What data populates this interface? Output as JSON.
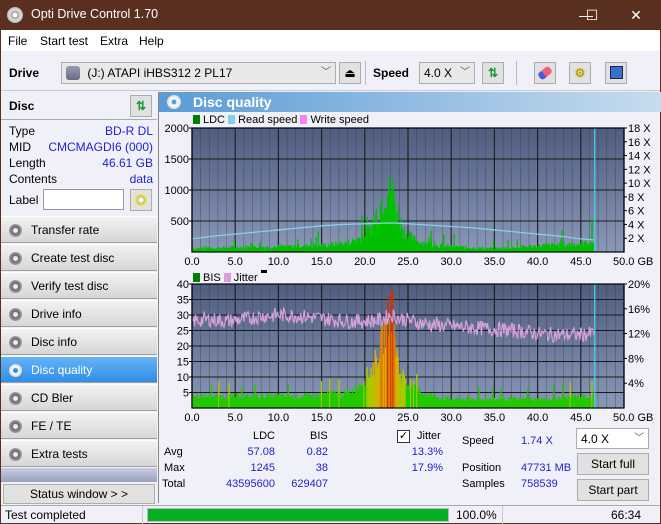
{
  "window": {
    "title": "Opti Drive Control 1.70",
    "minimize": "—",
    "maximize": "☐",
    "close": "✕"
  },
  "menu": [
    "File",
    "Start test",
    "Extra",
    "Help"
  ],
  "toolbar": {
    "drive_label": "Drive",
    "drive_value": "(J:)  ATAPI iHBS312  2 PL17",
    "speed_label": "Speed",
    "speed_value": "4.0 X",
    "icons": [
      "eject-icon",
      "refresh-icon",
      "erase-icon",
      "settings-icon",
      "save-icon"
    ]
  },
  "disc": {
    "title": "Disc",
    "fields": [
      {
        "key": "Type",
        "value": "BD-R DL"
      },
      {
        "key": "MID",
        "value": "CMCMAGDI6 (000)"
      },
      {
        "key": "Length",
        "value": "46.61 GB"
      },
      {
        "key": "Contents",
        "value": "data"
      }
    ],
    "label_key": "Label",
    "label_value": ""
  },
  "nav": [
    {
      "label": "Transfer rate",
      "active": false
    },
    {
      "label": "Create test disc",
      "active": false
    },
    {
      "label": "Verify test disc",
      "active": false
    },
    {
      "label": "Drive info",
      "active": false
    },
    {
      "label": "Disc info",
      "active": false
    },
    {
      "label": "Disc quality",
      "active": true
    },
    {
      "label": "CD Bler",
      "active": false
    },
    {
      "label": "FE / TE",
      "active": false
    },
    {
      "label": "Extra tests",
      "active": false
    }
  ],
  "status_window_label": "Status window > >",
  "panel_title": "Disc quality",
  "colors": {
    "ldc": "#00c000",
    "read_speed": "#87ceeb",
    "write_speed": "#ff80ff",
    "bis": "#008000",
    "jitter": "#d8a0d8",
    "plot_bg_top": "#4e5d80",
    "plot_bg_bottom": "#8a98b8",
    "progress": "#06b025"
  },
  "chart_data": [
    {
      "type": "bar",
      "title": "LDC / Read speed",
      "legend": [
        "LDC",
        "Read speed",
        "Write speed"
      ],
      "xlabel": "GB",
      "x_ticks": [
        "0.0",
        "5.0",
        "10.0",
        "15.0",
        "20.0",
        "25.0",
        "30.0",
        "35.0",
        "40.0",
        "45.0",
        "50.0 GB"
      ],
      "xlim": [
        0,
        50
      ],
      "ylim_left": [
        0,
        2000
      ],
      "y_ticks_left": [
        "500",
        "1000",
        "1500",
        "2000"
      ],
      "ylim_right": [
        0,
        18
      ],
      "y_ticks_right": [
        "2 X",
        "4 X",
        "6 X",
        "8 X",
        "10 X",
        "12 X",
        "14 X",
        "16 X",
        "18 X"
      ],
      "end_marker_gb": 46.61,
      "series": [
        {
          "name": "LDC",
          "x": [
            0,
            1,
            2,
            3,
            4,
            5,
            6,
            7,
            8,
            9,
            10,
            11,
            12,
            13,
            14,
            15,
            16,
            17,
            18,
            19,
            19.5,
            20,
            20.5,
            21,
            21.5,
            22,
            22.5,
            23,
            23.5,
            24,
            24.5,
            25,
            26,
            27,
            28,
            29,
            30,
            31,
            32,
            33,
            34,
            35,
            36,
            37,
            38,
            39,
            40,
            41,
            42,
            43,
            44,
            45,
            46,
            46.6
          ],
          "values": [
            60,
            70,
            80,
            75,
            80,
            85,
            90,
            90,
            95,
            90,
            100,
            100,
            105,
            110,
            115,
            120,
            130,
            150,
            170,
            220,
            260,
            300,
            380,
            550,
            750,
            950,
            1150,
            1245,
            900,
            600,
            400,
            300,
            200,
            160,
            130,
            110,
            100,
            90,
            80,
            75,
            70,
            65,
            70,
            80,
            90,
            100,
            110,
            120,
            125,
            130,
            140,
            150,
            170,
            180
          ]
        },
        {
          "name": "Read speed",
          "x": [
            0,
            2.5,
            5,
            7.5,
            10,
            12.5,
            15,
            17.5,
            20,
            22.5,
            23.4,
            25,
            27.5,
            30,
            32.5,
            35,
            37.5,
            40,
            42.5,
            45,
            46.6
          ],
          "values": [
            1.9,
            2.3,
            2.6,
            2.9,
            3.2,
            3.5,
            3.8,
            4.0,
            4.1,
            4.2,
            4.2,
            4.1,
            3.9,
            3.7,
            3.5,
            3.2,
            2.9,
            2.6,
            2.3,
            1.9,
            1.74
          ]
        }
      ]
    },
    {
      "type": "bar",
      "title": "BIS / Jitter",
      "legend": [
        "BIS",
        "Jitter"
      ],
      "xlabel": "GB",
      "x_ticks": [
        "0.0",
        "5.0",
        "10.0",
        "15.0",
        "20.0",
        "25.0",
        "30.0",
        "35.0",
        "40.0",
        "45.0",
        "50.0 GB"
      ],
      "xlim": [
        0,
        50
      ],
      "ylim_left": [
        0,
        40
      ],
      "y_ticks_left": [
        "5",
        "10",
        "15",
        "20",
        "25",
        "30",
        "35",
        "40"
      ],
      "ylim_right": [
        0,
        20
      ],
      "y_ticks_right": [
        "4%",
        "8%",
        "12%",
        "16%",
        "20%"
      ],
      "end_marker_gb": 46.61,
      "series": [
        {
          "name": "BIS",
          "x": [
            0,
            2,
            4,
            6,
            8,
            10,
            12,
            14,
            16,
            18,
            19,
            20,
            21,
            21.5,
            22,
            22.5,
            23,
            23.5,
            24,
            25,
            26,
            27,
            28,
            30,
            32,
            34,
            36,
            38,
            40,
            42,
            44,
            46,
            46.6
          ],
          "values": [
            4,
            4,
            4,
            4,
            4,
            4,
            4,
            4,
            5,
            5,
            7,
            10,
            14,
            18,
            23,
            27,
            38,
            24,
            12,
            8,
            6,
            5,
            4,
            3,
            3,
            3,
            3,
            3,
            3,
            3,
            4,
            4,
            4
          ]
        },
        {
          "name": "Jitter",
          "x": [
            0,
            2,
            4,
            6,
            8,
            10,
            12,
            14,
            16,
            18,
            20,
            22,
            23,
            24,
            26,
            28,
            30,
            32,
            34,
            36,
            38,
            40,
            42,
            44,
            46,
            46.6
          ],
          "values": [
            14.0,
            14.3,
            14.0,
            14.3,
            14.8,
            15.0,
            14.9,
            14.6,
            14.3,
            14.0,
            14.0,
            14.2,
            15.0,
            14.5,
            13.8,
            13.4,
            13.2,
            13.0,
            12.8,
            12.6,
            12.4,
            12.0,
            11.8,
            11.8,
            11.9,
            12.3
          ]
        }
      ]
    }
  ],
  "stats": {
    "col_ldc": "LDC",
    "col_bis": "BIS",
    "jitter_label": "Jitter",
    "jitter_checked": true,
    "rows": [
      {
        "label": "Avg",
        "ldc": "57.08",
        "bis": "0.82",
        "jitter": "13.3%"
      },
      {
        "label": "Max",
        "ldc": "1245",
        "bis": "38",
        "jitter": "17.9%"
      },
      {
        "label": "Total",
        "ldc": "43595600",
        "bis": "629407",
        "jitter": ""
      }
    ],
    "speed_label": "Speed",
    "speed_value": "1.74 X",
    "position_label": "Position",
    "position_value": "47731 MB",
    "samples_label": "Samples",
    "samples_value": "758539",
    "speed_select": "4.0 X",
    "start_full": "Start full",
    "start_part": "Start part"
  },
  "statusbar": {
    "text": "Test completed",
    "progress_percent": 100,
    "progress_text": "100.0%",
    "time": "66:34"
  }
}
